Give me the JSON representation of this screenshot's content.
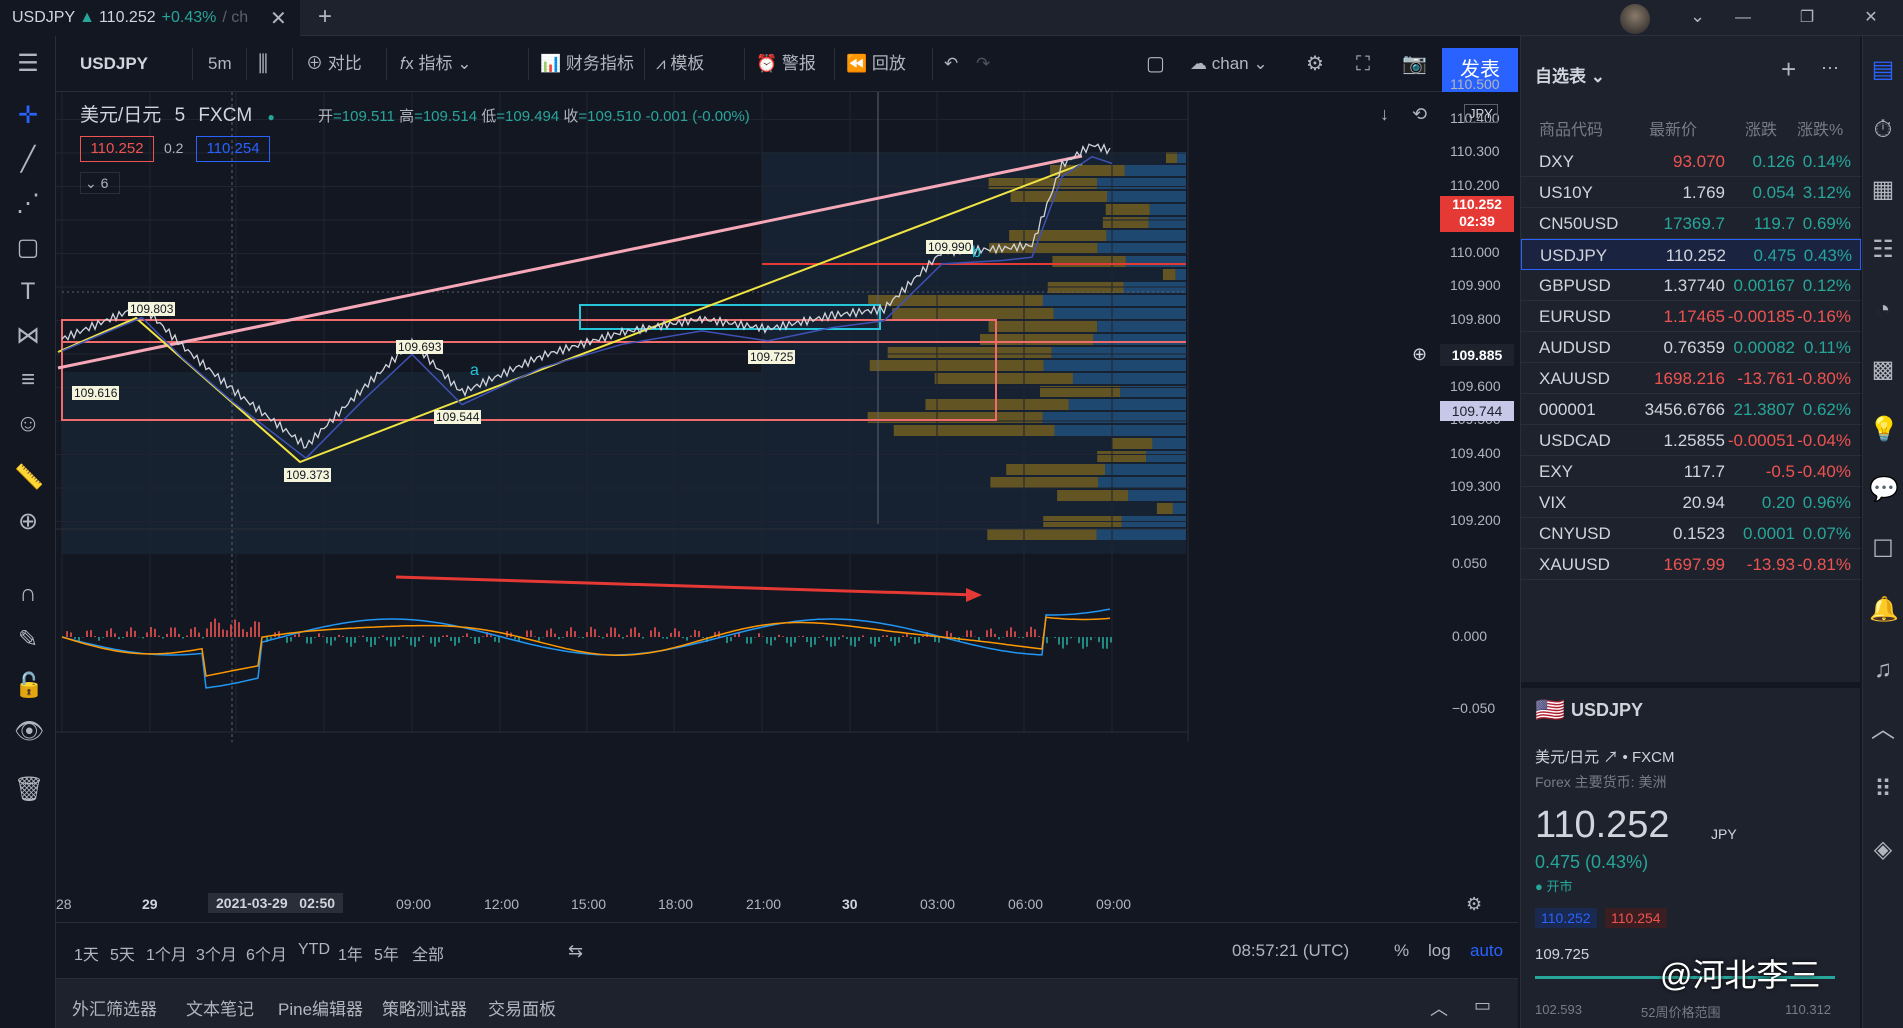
{
  "tab": {
    "symbol": "USDJPY",
    "arrow": "▲",
    "price": "110.252",
    "change": "+0.43%",
    "rest": "/ ch",
    "close": "✕"
  },
  "window": {
    "minimize": "—",
    "restore": "❐",
    "close": "✕",
    "dropdown": "⌄"
  },
  "toolbar": {
    "symbol": "USDJPY",
    "interval": "5m",
    "compare": "对比",
    "indicators": "指标",
    "financials": "财务指标",
    "templates": "模板",
    "alert": "警报",
    "replay": "回放",
    "layout_name": "chan",
    "publish": "发表"
  },
  "legend": {
    "title": "美元/日元",
    "interval": "5",
    "exchange": "FXCM",
    "o_label": "开",
    "o": "=109.511",
    "h_label": "高",
    "h": "=109.514",
    "l_label": "低",
    "l": "=109.494",
    "c_label": "收",
    "c": "=109.510",
    "chg": "-0.001 (-0.00%)",
    "bid": "110.252",
    "spread": "0.2",
    "ask": "110.254",
    "indicator_count": "6"
  },
  "price_axis": {
    "currency": "JPY",
    "ticks": [
      "110.500",
      "110.400",
      "110.300",
      "110.200",
      "110.100",
      "110.000",
      "109.900",
      "109.800",
      "109.700",
      "109.600",
      "109.500",
      "109.400",
      "109.300",
      "109.200"
    ],
    "current": "110.252",
    "countdown": "02:39",
    "crosshair": "109.885",
    "line": "109.744"
  },
  "macd_axis": {
    "ticks": [
      "0.050",
      "0.000",
      "−0.050"
    ]
  },
  "time_axis": {
    "ticks": [
      "28",
      "29",
      "06:00",
      "09:00",
      "12:00",
      "15:00",
      "18:00",
      "21:00",
      "30",
      "03:00",
      "06:00",
      "09:00"
    ],
    "cursor": "2021-03-29   02:50"
  },
  "annotations": [
    "109.803",
    "109.616",
    "109.693",
    "109.373",
    "109.544",
    "109.725",
    "109.990",
    "a",
    "b"
  ],
  "bottom": {
    "ranges": [
      "1天",
      "5天",
      "1个月",
      "3个月",
      "6个月",
      "YTD",
      "1年",
      "5年",
      "全部"
    ],
    "clock": "08:57:21 (UTC)",
    "pct": "%",
    "log": "log",
    "auto": "auto"
  },
  "panels": [
    "外汇筛选器",
    "文本笔记",
    "Pine编辑器",
    "策略测试器",
    "交易面板"
  ],
  "watchlist": {
    "title": "自选表",
    "headers": [
      "商品代码",
      "最新价",
      "涨跌",
      "涨跌%"
    ],
    "rows": [
      {
        "sym": "DXY",
        "last": "93.070",
        "chg": "0.126",
        "pct": "0.14%",
        "dir": "mix"
      },
      {
        "sym": "US10Y",
        "last": "1.769",
        "chg": "0.054",
        "pct": "3.12%",
        "dir": "up"
      },
      {
        "sym": "CN50USD",
        "last": "17369.7",
        "chg": "119.7",
        "pct": "0.69%",
        "dir": "up"
      },
      {
        "sym": "USDJPY",
        "last": "110.252",
        "chg": "0.475",
        "pct": "0.43%",
        "dir": "up"
      },
      {
        "sym": "GBPUSD",
        "last": "1.37740",
        "chg": "0.00167",
        "pct": "0.12%",
        "dir": "up"
      },
      {
        "sym": "EURUSD",
        "last": "1.17465",
        "chg": "-0.00185",
        "pct": "-0.16%",
        "dir": "dn"
      },
      {
        "sym": "AUDUSD",
        "last": "0.76359",
        "chg": "0.00082",
        "pct": "0.11%",
        "dir": "up"
      },
      {
        "sym": "XAUUSD",
        "last": "1698.216",
        "chg": "-13.761",
        "pct": "-0.80%",
        "dir": "dn"
      },
      {
        "sym": "000001",
        "last": "3456.6766",
        "chg": "21.3807",
        "pct": "0.62%",
        "dir": "up"
      },
      {
        "sym": "USDCAD",
        "last": "1.25855",
        "chg": "-0.00051",
        "pct": "-0.04%",
        "dir": "dn"
      },
      {
        "sym": "EXY",
        "last": "117.7",
        "chg": "-0.5",
        "pct": "-0.40%",
        "dir": "dn"
      },
      {
        "sym": "VIX",
        "last": "20.94",
        "chg": "0.20",
        "pct": "0.96%",
        "dir": "up"
      },
      {
        "sym": "CNYUSD",
        "last": "0.1523",
        "chg": "0.0001",
        "pct": "0.07%",
        "dir": "up"
      },
      {
        "sym": "XAUUSD",
        "last": "1697.99",
        "chg": "-13.93",
        "pct": "-0.81%",
        "dir": "dn"
      }
    ]
  },
  "details": {
    "sym": "USDJPY",
    "name": "美元/日元",
    "exchange": "FXCM",
    "desc": "Forex 主要货币: 美洲",
    "price": "110.252",
    "ccy": "JPY",
    "chg": "0.475 (0.43%)",
    "status": "开市",
    "bid": "110.252",
    "ask": "110.254",
    "low": "109.725",
    "range_low": "102.593",
    "range_label": "52周价格范围",
    "range_high": "110.312"
  },
  "watermark": "@河北李三",
  "colors": {
    "up": "#26a69a",
    "down": "#ef5350",
    "accent": "#2962ff",
    "bg": "#131722"
  }
}
